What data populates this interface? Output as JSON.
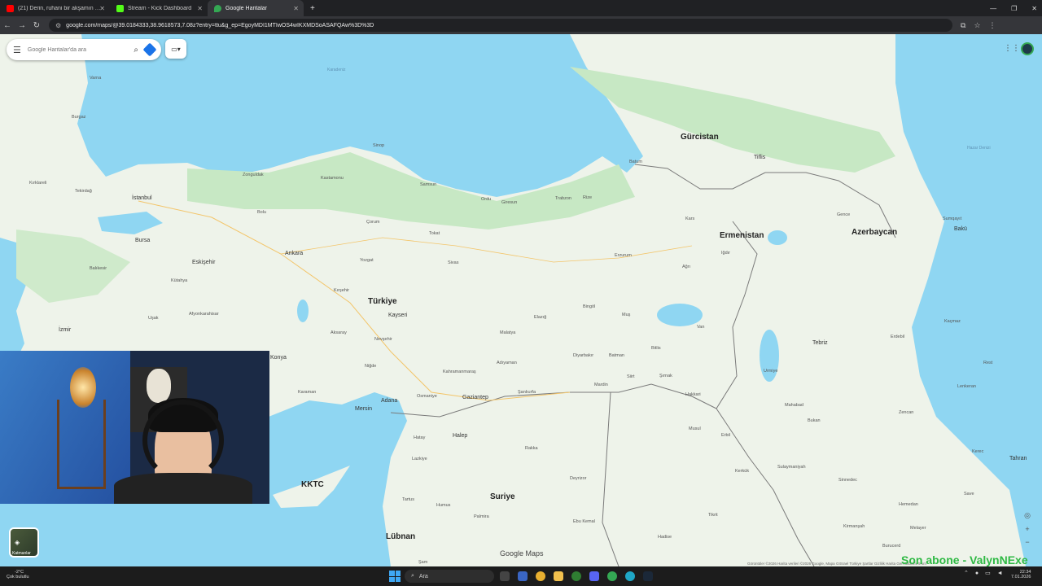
{
  "browser": {
    "tabs": [
      {
        "title": "(21) Derin, ruhani bir akşamın …",
        "icon": "youtube-icon",
        "color": "#ff0000",
        "active": false
      },
      {
        "title": "Stream - Kick Dashboard",
        "icon": "kick-icon",
        "color": "#53fc18",
        "active": false
      },
      {
        "title": "Google Haritalar",
        "icon": "maps-pin-icon",
        "color": "#34a853",
        "active": true
      }
    ],
    "new_tab_symbol": "+",
    "url": "google.com/maps/@39.0184333,38.9618573,7.08z?entry=ttu&g_ep=EgoyMDI1MTIwOS4wIKXMDSoASAFQAw%3D%3D"
  },
  "maps": {
    "search_placeholder": "Google Haritalar'da ara",
    "logo_text": "Google Maps",
    "attribution": "Görüntüler ©2026 Harita verileri ©2026 Google, Mapa GISrael   Türkiye   Şartlar   Gizlilik   Harita Geri Bildirimi   5 km",
    "layers_label": "Katmanlar",
    "labels": {
      "countries": [
        "Türkiye",
        "Gürcistan",
        "Ermenistan",
        "Azerbaycan",
        "Suriye",
        "Lübnan",
        "KKTC"
      ],
      "seas": [
        "Karadeniz",
        "Hazar Denizi"
      ],
      "cities": [
        "İstanbul",
        "Ankara",
        "Bursa",
        "Eskişehir",
        "İzmir",
        "Konya",
        "Kayseri",
        "Adana",
        "Mersin",
        "Gaziantep",
        "Halep",
        "Tebriz",
        "Bakü",
        "Tiflis",
        "Erzurum",
        "Trabzon",
        "Samsun",
        "Malatya",
        "Diyarbakır",
        "Van",
        "Erbil",
        "Musul",
        "Humus",
        "Şam",
        "Sivas",
        "Çorum",
        "Tokat",
        "Ordu",
        "Giresun",
        "Rize",
        "Batum",
        "Kars",
        "Şanlıurfa",
        "Mardin",
        "Batman",
        "Elazığ",
        "Adıyaman",
        "Kahramanmaraş",
        "Hatay",
        "Osmaniye",
        "Zonguldak",
        "Kastamonu",
        "Sinop",
        "Bolu",
        "Tekirdağ",
        "Balıkesir",
        "Kütahya",
        "Afyonkarahisar",
        "Uşak",
        "Aksaray",
        "Karaman",
        "Gence",
        "Sumqayıt",
        "Lenkeran",
        "Zencan",
        "Bukan",
        "Sulaymaniyah",
        "Kerkük",
        "Rakka",
        "Deyrizor",
        "Tartus",
        "Lazkiye",
        "Varna",
        "Burgaz",
        "Kırklareli",
        "Yozgat",
        "Kırşehir",
        "Nevşehir",
        "Niğde",
        "Bingöl",
        "Muş",
        "Bitlis",
        "Siirt",
        "Şırnak",
        "Hakkari",
        "Ağrı",
        "Iğdır",
        "Urmiye",
        "Mahabad",
        "Erdebil",
        "Rest",
        "Kaçmaz",
        "Tahran",
        "Kerec",
        "Hemedan",
        "Save",
        "Burucerd",
        "Melayer",
        "Sinnedec",
        "Kirmanşah",
        "Tikrit",
        "Ebu Kemal",
        "Palmira",
        "Hadise"
      ]
    }
  },
  "stream_overlay": {
    "text": "Son abone - ValynNExe"
  },
  "taskbar": {
    "weather_temp": "-2°C",
    "weather_text": "Çok bulutlu",
    "search_label": "Ara",
    "time": "22:34",
    "date": "7.01.2026"
  },
  "colors": {
    "sea": "#8fd6f2",
    "land": "#eef3ea",
    "forest": "#c7e8c4",
    "border": "#7a7a7a",
    "kick_green": "#2fb944"
  }
}
